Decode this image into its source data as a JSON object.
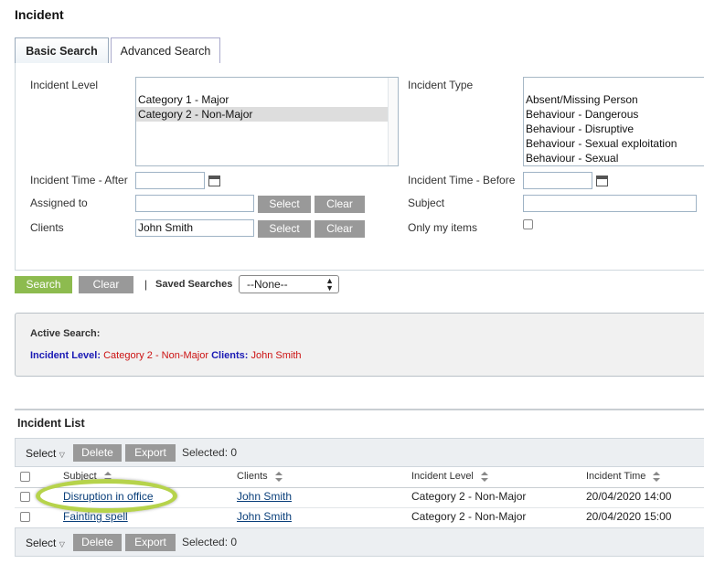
{
  "page": {
    "title": "Incident"
  },
  "tabs": [
    {
      "label": "Basic Search",
      "active": true
    },
    {
      "label": "Advanced Search",
      "active": false
    }
  ],
  "form": {
    "incident_level_label": "Incident Level",
    "incident_level_options": [
      "Category 1 - Major",
      "Category 2 - Non-Major"
    ],
    "incident_type_label": "Incident Type",
    "incident_type_options": [
      "Absent/Missing Person",
      "Behaviour - Dangerous",
      "Behaviour - Disruptive",
      "Behaviour - Sexual exploitation",
      "Behaviour - Sexual"
    ],
    "time_after_label": "Incident Time - After",
    "time_after_value": "",
    "time_before_label": "Incident Time - Before",
    "time_before_value": "",
    "assigned_label": "Assigned to",
    "assigned_value": "",
    "subject_label": "Subject",
    "subject_value": "",
    "clients_label": "Clients",
    "clients_value": "John Smith",
    "only_my_items_label": "Only my items",
    "select_label": "Select",
    "clear_label": "Clear"
  },
  "actions": {
    "search_label": "Search",
    "clear_label": "Clear",
    "separator": "|",
    "saved_searches_label": "Saved Searches",
    "saved_searches_value": "--None--"
  },
  "active_search": {
    "heading": "Active Search:",
    "level_label": "Incident Level:",
    "level_value": "Category 2 - Non-Major",
    "clients_label": "Clients:",
    "clients_value": "John Smith"
  },
  "incident_list": {
    "heading": "Incident List",
    "toolbar": {
      "select_label": "Select",
      "delete_label": "Delete",
      "export_label": "Export",
      "selected_text": "Selected: 0"
    },
    "columns": [
      "Subject",
      "Clients",
      "Incident Level",
      "Incident Time"
    ],
    "rows": [
      {
        "subject": "Disruption in office",
        "client": "John Smith",
        "level": "Category 2 - Non-Major",
        "time": "20/04/2020 14:00"
      },
      {
        "subject": "Fainting spell",
        "client": "John Smith",
        "level": "Category 2 - Non-Major",
        "time": "20/04/2020 15:00"
      }
    ]
  },
  "colors": {
    "accent_green": "#8dbb4f",
    "highlight": "#b6d34b",
    "label_blue": "#1a1ab5",
    "value_red": "#cc1111"
  }
}
